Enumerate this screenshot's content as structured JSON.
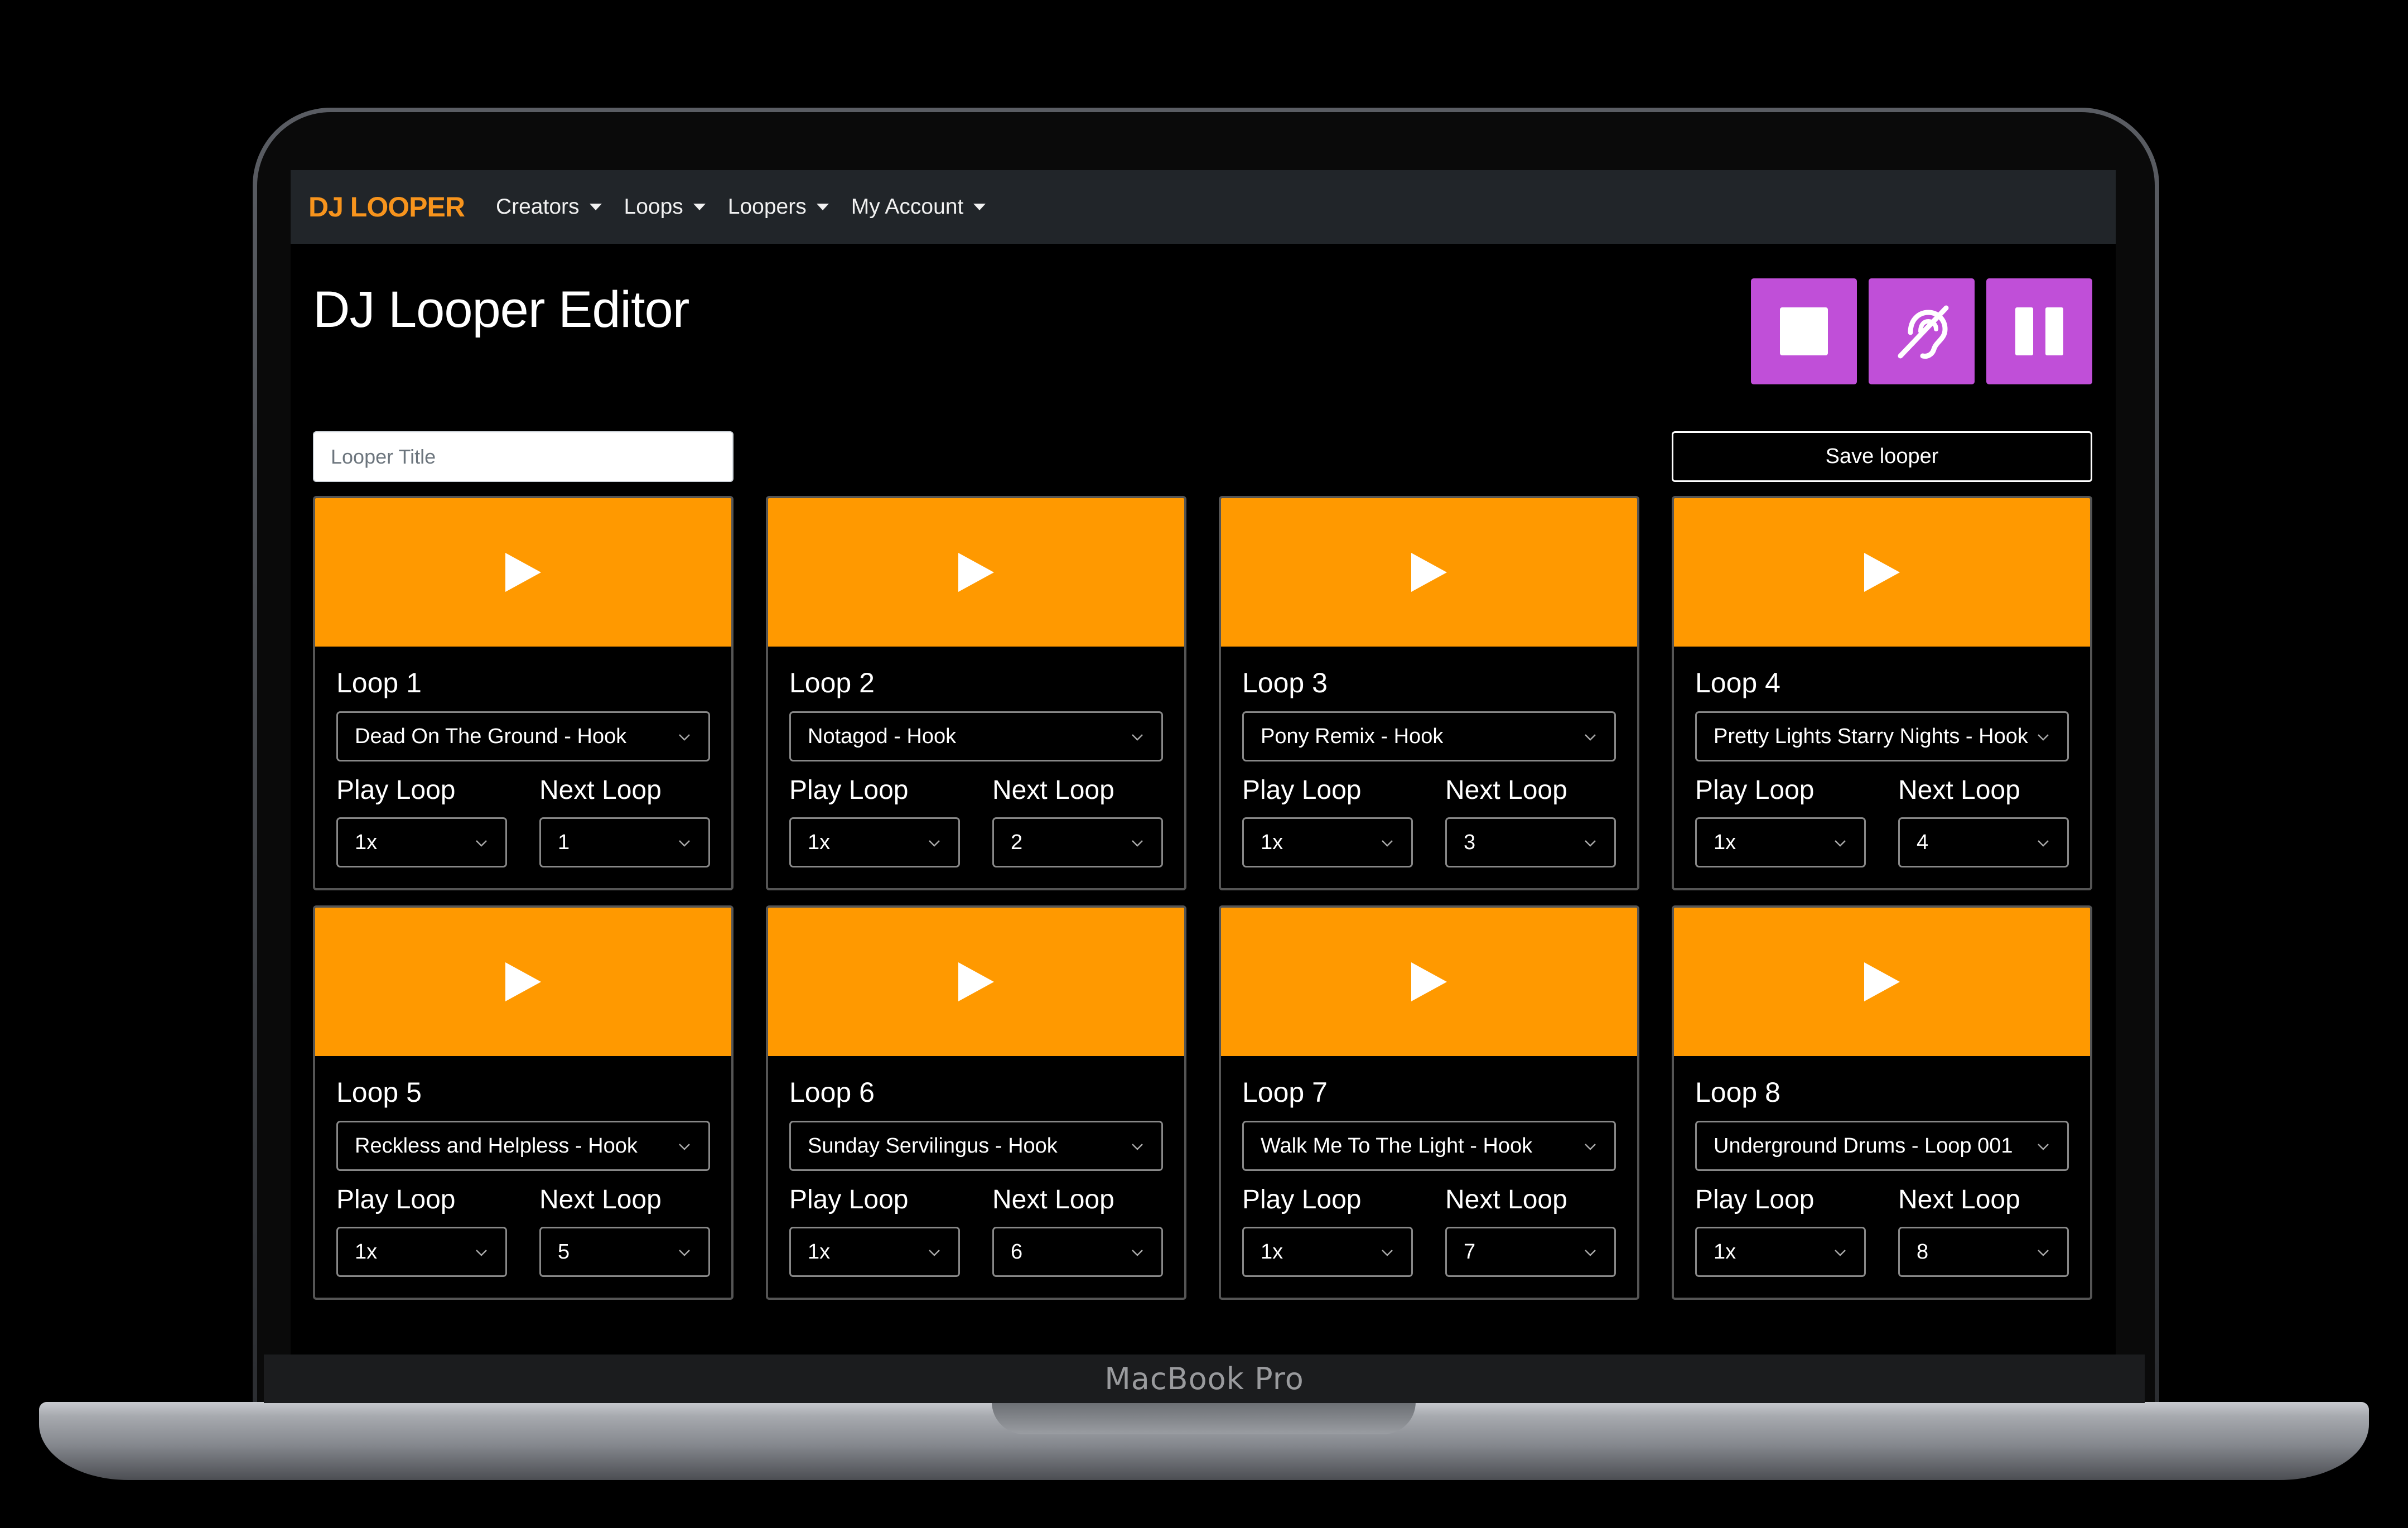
{
  "device": {
    "label": "MacBook Pro"
  },
  "nav": {
    "brand": "DJ LOOPER",
    "items": [
      {
        "label": "Creators"
      },
      {
        "label": "Loops"
      },
      {
        "label": "Loopers"
      },
      {
        "label": "My Account"
      }
    ]
  },
  "page": {
    "title": "DJ Looper Editor"
  },
  "controls": {
    "icons": [
      "stop-icon",
      "hearing-disabled-icon",
      "pause-icon"
    ],
    "color": "#c04fd8"
  },
  "form": {
    "title_placeholder": "Looper Title",
    "save_label": "Save looper"
  },
  "colors": {
    "accent": "#ff9900",
    "brand": "#f7941d",
    "navbar": "#212529"
  },
  "card_labels": {
    "play": "Play Loop",
    "next": "Next Loop"
  },
  "loops": [
    {
      "title": "Loop 1",
      "track": "Dead On The Ground - Hook",
      "play": "1x",
      "next": "1"
    },
    {
      "title": "Loop 2",
      "track": "Notagod - Hook",
      "play": "1x",
      "next": "2"
    },
    {
      "title": "Loop 3",
      "track": "Pony Remix - Hook",
      "play": "1x",
      "next": "3"
    },
    {
      "title": "Loop 4",
      "track": "Pretty Lights Starry Nights - Hook",
      "play": "1x",
      "next": "4"
    },
    {
      "title": "Loop 5",
      "track": "Reckless and Helpless - Hook",
      "play": "1x",
      "next": "5"
    },
    {
      "title": "Loop 6",
      "track": "Sunday Servilingus - Hook",
      "play": "1x",
      "next": "6"
    },
    {
      "title": "Loop 7",
      "track": "Walk Me To The Light - Hook",
      "play": "1x",
      "next": "7"
    },
    {
      "title": "Loop 8",
      "track": "Underground Drums - Loop 001",
      "play": "1x",
      "next": "8"
    }
  ]
}
